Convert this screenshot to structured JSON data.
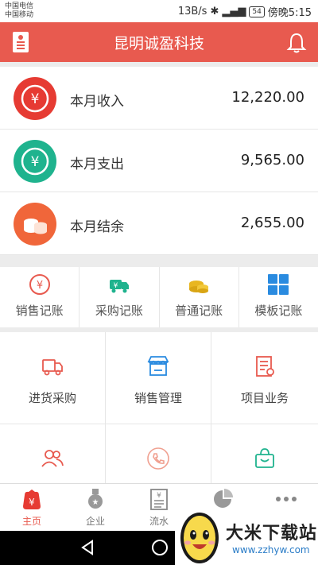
{
  "statusbar": {
    "carrier1": "中国电信",
    "carrier2": "中国移动",
    "speed": "13B/s",
    "battery": "54",
    "time": "傍晚5:15"
  },
  "header": {
    "title": "昆明诚盈科技"
  },
  "summary": [
    {
      "label": "本月收入",
      "amount": "12,220.00",
      "color": "#e63b33",
      "icon": "yuan-icon"
    },
    {
      "label": "本月支出",
      "amount": "9,565.00",
      "color": "#1fb38e",
      "icon": "yuan-icon"
    },
    {
      "label": "本月结余",
      "amount": "2,655.00",
      "color": "#f0663a",
      "icon": "coins-icon"
    }
  ],
  "quick": [
    {
      "label": "销售记账",
      "icon": "yuan-circle-icon"
    },
    {
      "label": "采购记账",
      "icon": "truck-icon"
    },
    {
      "label": "普通记账",
      "icon": "coins-icon"
    },
    {
      "label": "模板记账",
      "icon": "grid-icon"
    }
  ],
  "grid": [
    {
      "label": "进货采购",
      "icon": "truck-icon"
    },
    {
      "label": "销售管理",
      "icon": "store-icon"
    },
    {
      "label": "项目业务",
      "icon": "document-icon"
    },
    {
      "label": "",
      "icon": "users-icon"
    },
    {
      "label": "",
      "icon": "phone-icon"
    },
    {
      "label": "",
      "icon": "bag-icon"
    }
  ],
  "tabs": [
    {
      "label": "主页",
      "icon": "home-yuan-icon",
      "active": true
    },
    {
      "label": "企业",
      "icon": "medal-icon",
      "active": false
    },
    {
      "label": "流水",
      "icon": "receipt-icon",
      "active": false
    },
    {
      "label": "",
      "icon": "pie-chart-icon",
      "active": false
    },
    {
      "label": "",
      "icon": "more-icon",
      "active": false
    }
  ],
  "watermark": {
    "title": "大米下载站",
    "url": "www.zzhyw.com"
  },
  "colors": {
    "brand": "#e85a4f",
    "green": "#1fb38e",
    "orange": "#f0663a",
    "blue": "#2a8be0",
    "gold": "#e8b620"
  }
}
